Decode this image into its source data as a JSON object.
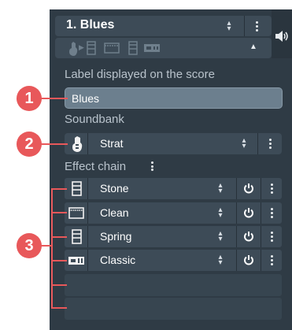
{
  "track": {
    "name": "1. Blues"
  },
  "labels": {
    "label_on_score": "Label displayed on the score",
    "soundbank": "Soundbank",
    "effect_chain": "Effect chain"
  },
  "score_label": {
    "value": "Blues"
  },
  "soundbank": {
    "value": "Strat",
    "icon": "guitar-icon"
  },
  "effects": [
    {
      "name": "Stone",
      "icon": "amp-stack-icon"
    },
    {
      "name": "Clean",
      "icon": "amp-combo-icon"
    },
    {
      "name": "Spring",
      "icon": "amp-stack-icon"
    },
    {
      "name": "Classic",
      "icon": "amp-head-icon"
    }
  ],
  "callouts": [
    "1",
    "2",
    "3"
  ],
  "colors": {
    "panel": "#2f3b45",
    "row": "#3d4b57",
    "field": "#6c7f8e",
    "callout": "#e8585a"
  }
}
